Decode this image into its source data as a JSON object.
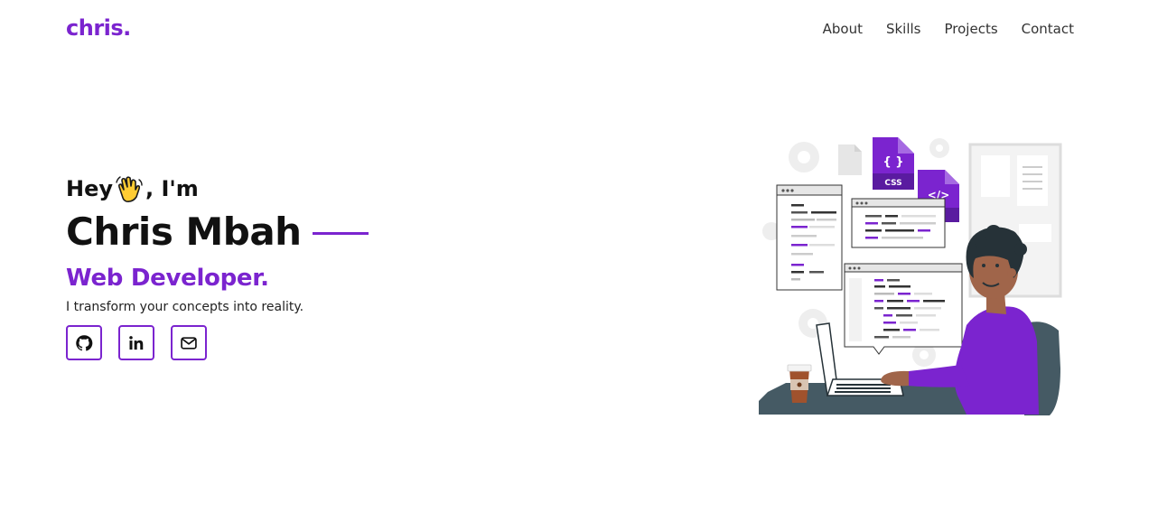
{
  "brand": {
    "logo": "chris."
  },
  "nav": {
    "items": [
      "About",
      "Skills",
      "Projects",
      "Contact"
    ]
  },
  "hero": {
    "greeting_before": "Hey",
    "greeting_after": ", I'm",
    "name": "Chris Mbah",
    "role": "Web Developer.",
    "tagline": "I transform your concepts into reality."
  },
  "socials": [
    {
      "icon": "github-icon"
    },
    {
      "icon": "linkedin-icon"
    },
    {
      "icon": "mail-icon"
    }
  ],
  "illustration": {
    "css_label": "CSS",
    "html_label": "</>"
  },
  "colors": {
    "accent": "#7b24cf",
    "text": "#111111",
    "desk": "#455a64"
  }
}
